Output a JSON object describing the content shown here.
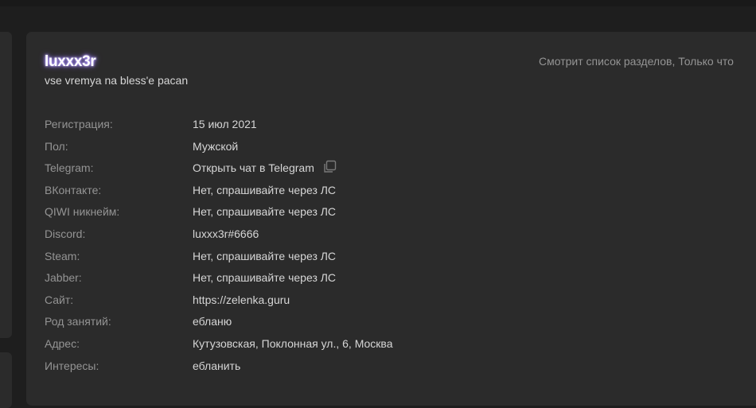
{
  "profile": {
    "username": "luxxx3r",
    "status": "vse vremya na bless'e pacan",
    "activity": "Смотрит список разделов, Только что"
  },
  "info_rows": [
    {
      "label": "Регистрация:",
      "value": "15 июл 2021"
    },
    {
      "label": "Пол:",
      "value": "Мужской"
    },
    {
      "label": "Telegram:",
      "value": "Открыть чат в Telegram",
      "icon": "copy-icon"
    },
    {
      "label": "ВКонтакте:",
      "value": "Нет, спрашивайте через ЛС"
    },
    {
      "label": "QIWI никнейм:",
      "value": "Нет, спрашивайте через ЛС"
    },
    {
      "label": "Discord:",
      "value": "luxxx3r#6666"
    },
    {
      "label": "Steam:",
      "value": "Нет, спрашивайте через ЛС"
    },
    {
      "label": "Jabber:",
      "value": "Нет, спрашивайте через ЛС"
    },
    {
      "label": "Сайт:",
      "value": "https://zelenka.guru"
    },
    {
      "label": "Род занятий:",
      "value": "ебланю"
    },
    {
      "label": "Адрес:",
      "value": "Кутузовская, Поклонная ул., 6, Москва"
    },
    {
      "label": "Интересы:",
      "value": "ебланить"
    }
  ],
  "colors": {
    "background": "#1e1e1e",
    "card": "#2b2b2b",
    "label": "#949494",
    "value": "#d6d6d6",
    "username_glow": "#8c6cff"
  }
}
